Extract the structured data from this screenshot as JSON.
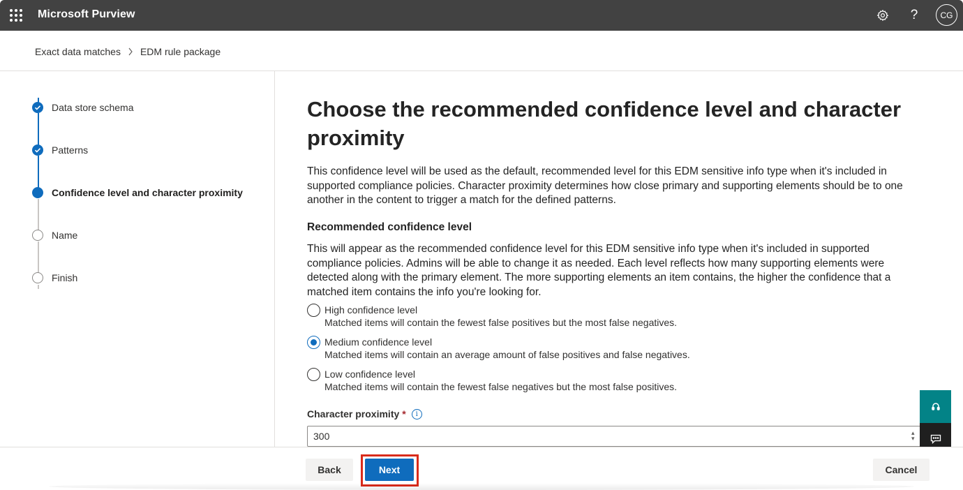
{
  "app": {
    "title": "Microsoft Purview",
    "user_initials": "CG"
  },
  "topbar": {
    "icons": [
      "waffle-icon",
      "gear-icon",
      "help-icon"
    ],
    "help_glyph": "?"
  },
  "breadcrumb": {
    "items": [
      "Exact data matches",
      "EDM rule package"
    ]
  },
  "steps": [
    {
      "label": "Data store schema",
      "state": "done"
    },
    {
      "label": "Patterns",
      "state": "done"
    },
    {
      "label": "Confidence level and character proximity",
      "state": "current"
    },
    {
      "label": "Name",
      "state": "todo"
    },
    {
      "label": "Finish",
      "state": "todo"
    }
  ],
  "main": {
    "title": "Choose the recommended confidence level and character proximity",
    "description": "This confidence level will be used as the default, recommended level for this EDM sensitive info type when it's included in supported compliance policies. Character proximity determines how close primary and supporting elements should be to one another in the content to trigger a match for the defined patterns.",
    "confidence": {
      "heading": "Recommended confidence level",
      "description": "This will appear as the recommended confidence level for this EDM sensitive info type when it's included in supported compliance policies. Admins will be able to change it as needed. Each level reflects how many supporting elements were detected along with the primary element. The more supporting elements an item contains, the higher the confidence that a matched item contains the info you're looking for.",
      "options": [
        {
          "label": "High confidence level",
          "sub": "Matched items will contain the fewest false positives but the most false negatives.",
          "checked": false
        },
        {
          "label": "Medium confidence level",
          "sub": "Matched items will contain an average amount of false positives and false negatives.",
          "checked": true
        },
        {
          "label": "Low confidence level",
          "sub": "Matched items will contain the fewest false negatives but the most false positives.",
          "checked": false
        }
      ]
    },
    "proximity": {
      "label": "Character proximity",
      "required_mark": "*",
      "value": "300"
    }
  },
  "footer": {
    "back_label": "Back",
    "next_label": "Next",
    "cancel_label": "Cancel"
  },
  "colors": {
    "topbar": "#424242",
    "accent": "#0f6cbd",
    "highlight": "#d92b1b",
    "widget_teal": "#038387"
  }
}
